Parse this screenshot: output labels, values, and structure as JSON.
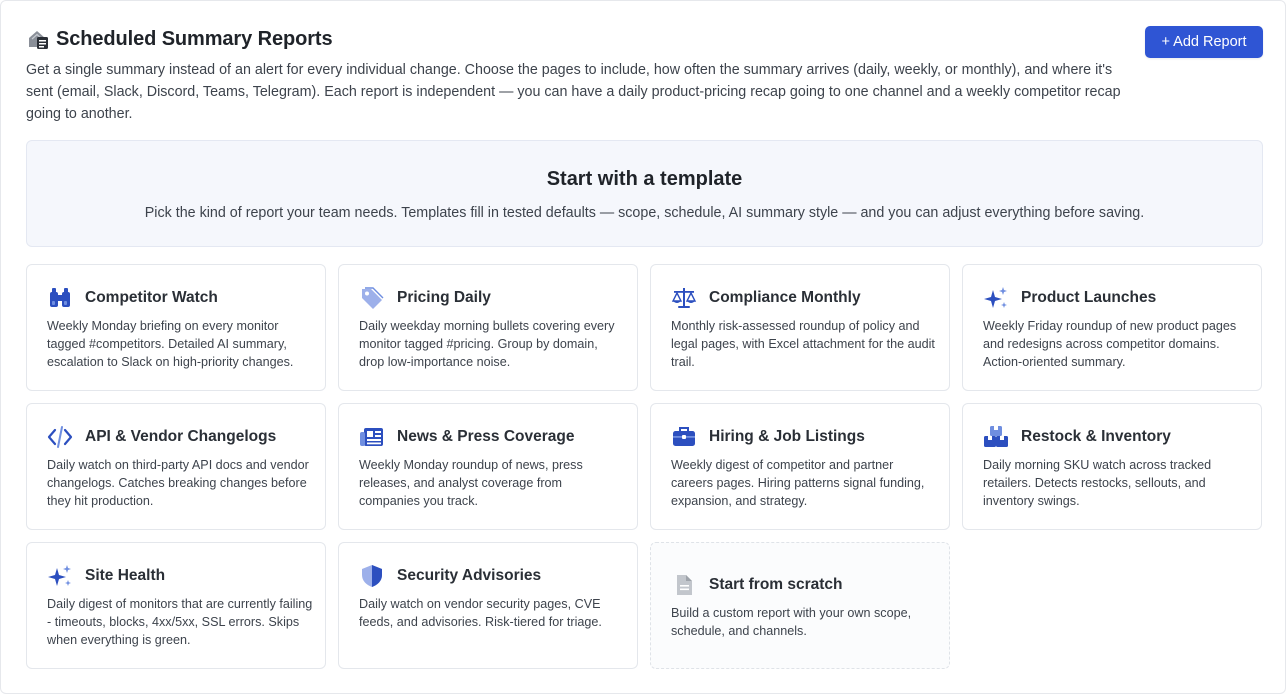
{
  "header": {
    "title": "Scheduled Summary Reports",
    "add_button": "+ Add Report",
    "description": "Get a single summary instead of an alert for every individual change. Choose the pages to include, how often the summary arrives (daily, weekly, or monthly), and where it's sent (email, Slack, Discord, Teams, Telegram). Each report is independent — you can have a daily product-pricing recap going to one channel and a weekly competitor recap going to another."
  },
  "templates_section": {
    "title": "Start with a template",
    "subtitle": "Pick the kind of report your team needs. Templates fill in tested defaults — scope, schedule, AI summary style — and you can adjust everything before saving."
  },
  "cards": [
    {
      "title": "Competitor Watch",
      "text": "Weekly Monday briefing on every monitor tagged #competitors. Detailed AI summary, escalation to Slack on high-priority changes.",
      "icon": "binoculars-icon"
    },
    {
      "title": "Pricing Daily",
      "text": "Daily weekday morning bullets covering every monitor tagged #pricing. Group by domain, drop low-importance noise.",
      "icon": "price-tag-icon"
    },
    {
      "title": "Compliance Monthly",
      "text": "Monthly risk-assessed roundup of policy and legal pages, with Excel attachment for the audit trail.",
      "icon": "scales-icon"
    },
    {
      "title": "Product Launches",
      "text": "Weekly Friday roundup of new product pages and redesigns across competitor domains. Action-oriented summary.",
      "icon": "sparkles-icon"
    },
    {
      "title": "API & Vendor Changelogs",
      "text": "Daily watch on third-party API docs and vendor changelogs. Catches breaking changes before they hit production.",
      "icon": "code-icon"
    },
    {
      "title": "News & Press Coverage",
      "text": "Weekly Monday roundup of news, press releases, and analyst coverage from companies you track.",
      "icon": "newspaper-icon"
    },
    {
      "title": "Hiring & Job Listings",
      "text": "Weekly digest of competitor and partner careers pages. Hiring patterns signal funding, expansion, and strategy.",
      "icon": "briefcase-icon"
    },
    {
      "title": "Restock & Inventory",
      "text": "Daily morning SKU watch across tracked retailers. Detects restocks, sellouts, and inventory swings.",
      "icon": "boxes-icon"
    },
    {
      "title": "Site Health",
      "text": "Daily digest of monitors that are currently failing - timeouts, blocks, 4xx/5xx, SSL errors. Skips when everything is green.",
      "icon": "sparkles-icon"
    },
    {
      "title": "Security Advisories",
      "text": "Daily watch on vendor security pages, CVE feeds, and advisories. Risk-tiered for triage.",
      "icon": "shield-icon"
    },
    {
      "title": "Start from scratch",
      "text": "Build a custom report with your own scope, schedule, and channels.",
      "icon": "document-icon"
    }
  ],
  "colors": {
    "accent": "#2f55d4",
    "icon_blue": "#2c4fbf",
    "icon_light": "#6f8ee0"
  }
}
